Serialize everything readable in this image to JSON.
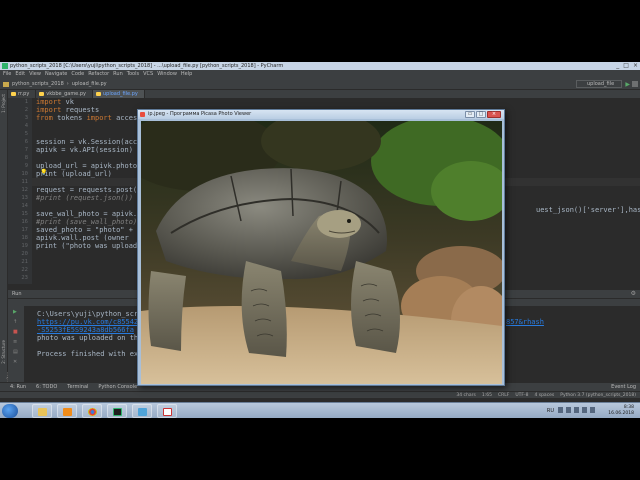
{
  "ide": {
    "window_title": "python_scripts_2018 [C:\\Users\\yuji\\python_scripts_2018] - ...\\upload_file.py [python_scripts_2018] - PyCharm",
    "window_controls": [
      "_",
      "□",
      "×"
    ],
    "menu": [
      "File",
      "Edit",
      "View",
      "Navigate",
      "Code",
      "Refactor",
      "Run",
      "Tools",
      "VCS",
      "Window",
      "Help"
    ],
    "breadcrumb": [
      "python_scripts_2018",
      "upload_file.py"
    ],
    "run_config": "upload_file",
    "tabs": [
      {
        "label": "rr.py",
        "active": false
      },
      {
        "label": "vkbbe_game.py",
        "active": false
      },
      {
        "label": "upload_file.py",
        "active": true
      }
    ],
    "line_numbers": [
      "1",
      "2",
      "3",
      "4",
      "5",
      "6",
      "7",
      "8",
      "9",
      "10",
      "11",
      "12",
      "13",
      "14",
      "15",
      "16",
      "17",
      "18",
      "19",
      "20",
      "21",
      "22",
      "23"
    ],
    "code": {
      "l1": "import vk",
      "l2": "import requests",
      "l3": "from tokens import access",
      "l5": "session = vk.Session(acce",
      "l6": "apivk = vk.API(session)",
      "l8": "upload_url = apivk.photos",
      "l9": "print (upload_url)",
      "l11": "request = requests.post(u",
      "l12": "#print (request.json())",
      "l14": "save_wall_photo = apivk.p",
      "l15": "#print (save_wall_photo)",
      "l16": "saved_photo = \"photo\" + ",
      "l17": "apivk.wall.post (owner",
      "l18": "print (\"photo was upload",
      "right_fragment": "uest_json()['server'],hash_=reque"
    },
    "editor_breadcrumb": "try{}",
    "run_panel": {
      "header": "Run",
      "tab": "upload_file",
      "lines": [
        "C:\\Users\\yuji\\python_scr",
        "https://pu.vk.com/c85542",
        "-S5253fE5S9243a8db566fa",
        "photo was uploaded on the",
        "",
        "Process finished with ex"
      ],
      "link_right_1": "857&rhash",
      "link_right_2": ""
    },
    "tool_buttons": [
      "4: Run",
      "6: TODO",
      "Terminal",
      "Python Console"
    ],
    "tool_buttons_right": "Event Log",
    "status_items": [
      "34 chars",
      "1:65",
      "CRLF",
      "UTF-8",
      "4 spaces",
      "Python 3.7 (python_scripts_2018)"
    ],
    "left_strip_labels": [
      "1: Project",
      "2: Structure",
      "2: Favorites"
    ]
  },
  "viewer": {
    "title": "ip.jpeg - Программа Picasa Photo Viewer",
    "controls": [
      "▭",
      "□",
      "×"
    ],
    "image_alt": "giant tortoise photo"
  },
  "taskbar": {
    "apps": [
      "explorer",
      "media-player",
      "sublime-text",
      "chrome",
      "pycharm",
      "picasa-viewer",
      "pdf-reader"
    ],
    "language": "RU",
    "time": "8:38",
    "date": "16.06.2018"
  },
  "colors": {
    "ide_bg": "#2b2b2b",
    "keyword": "#cc7832",
    "string": "#6a8759",
    "comment": "#808080",
    "link": "#287bde"
  }
}
